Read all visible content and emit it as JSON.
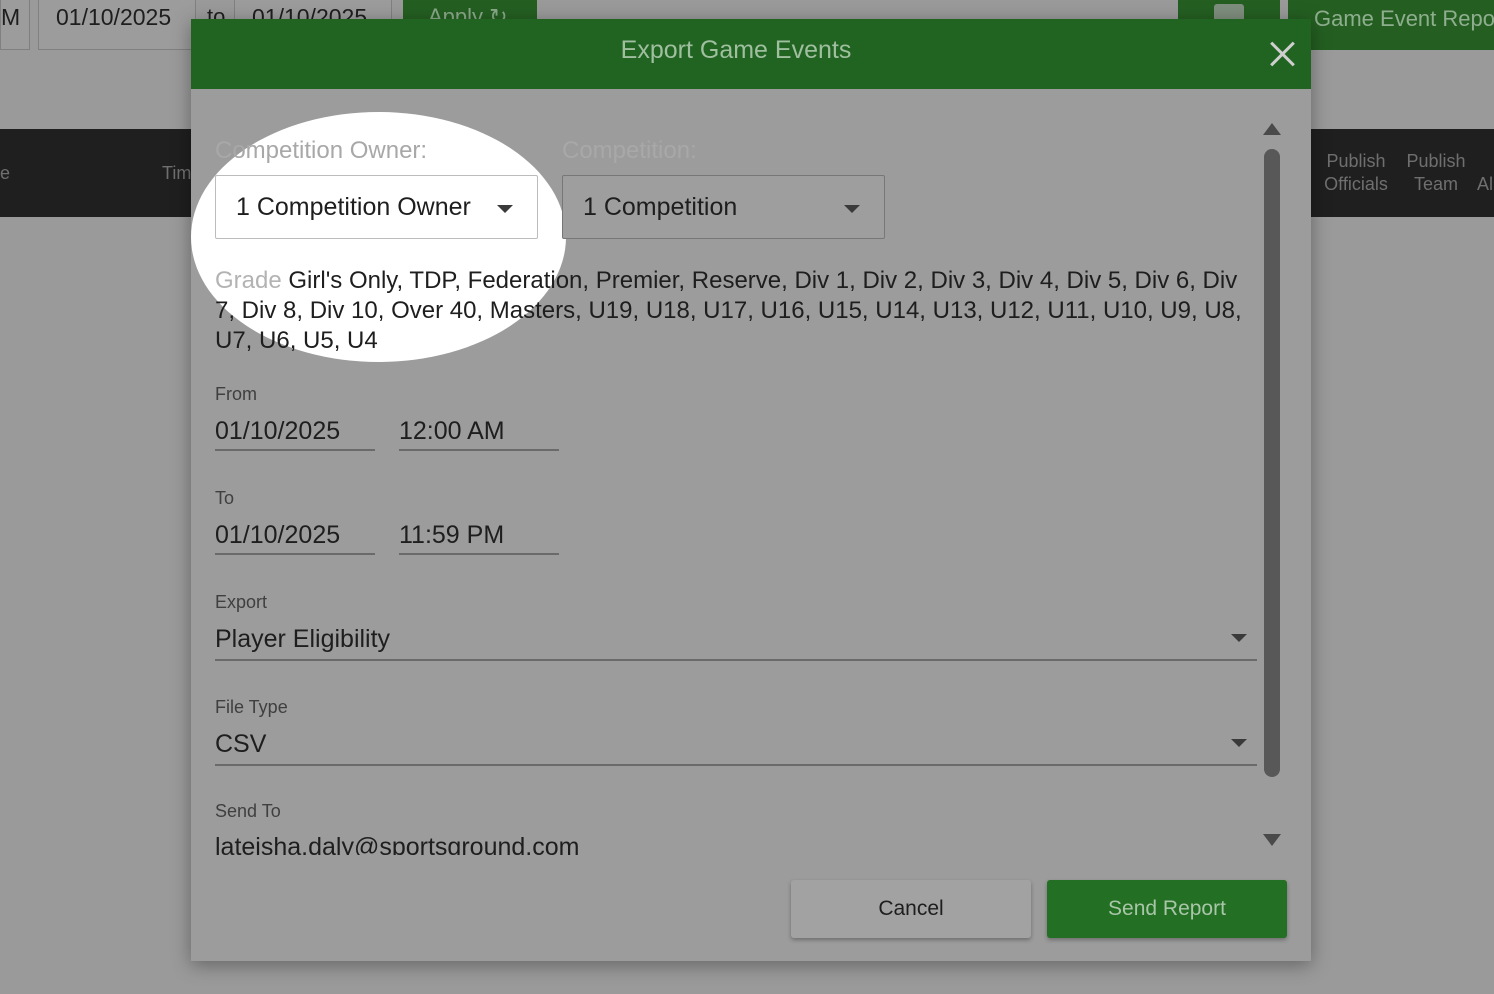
{
  "background": {
    "left_partial_text": "M",
    "date_from": "01/10/2025",
    "to_label": "to",
    "date_to": "01/10/2025",
    "apply_label": "Apply",
    "apply_icon": "refresh-icon",
    "calendar_icon": "calendar-icon",
    "report_button": "Game Event Repor",
    "columns": {
      "left_partial": "e",
      "time_partial": "Tim",
      "publish_officials_1": "Publish",
      "publish_officials_2": "Officials",
      "publish_team_1": "Publish",
      "publish_team_2": "Team",
      "partial_right": "Al"
    }
  },
  "modal": {
    "title": "Export Game Events",
    "close_icon": "close-icon",
    "competition_owner": {
      "label": "Competition Owner:",
      "value": "1 Competition Owner"
    },
    "competition": {
      "label": "Competition:",
      "value": "1 Competition"
    },
    "grade": {
      "label": "Grade",
      "value": "Girl's Only, TDP, Federation, Premier, Reserve, Div 1, Div 2, Div 3, Div 4, Div 5, Div 6, Div 7, Div 8, Div 10, Over 40, Masters, U19, U18, U17, U16, U15, U14, U13, U12, U11, U10, U9, U8, U7, U6, U5, U4"
    },
    "from": {
      "label": "From",
      "date": "01/10/2025",
      "time": "12:00 AM"
    },
    "to": {
      "label": "To",
      "date": "01/10/2025",
      "time": "11:59 PM"
    },
    "export": {
      "label": "Export",
      "value": "Player Eligibility"
    },
    "file_type": {
      "label": "File Type",
      "value": "CSV"
    },
    "send_to": {
      "label": "Send To",
      "value": "lateisha.daly@sportsground.com"
    },
    "cancel_label": "Cancel",
    "send_label": "Send Report"
  },
  "colors": {
    "header_green": "#216321",
    "button_green": "#236f23",
    "overlay_gray": "#9a9a9a",
    "spotlight": "#ffffff"
  }
}
